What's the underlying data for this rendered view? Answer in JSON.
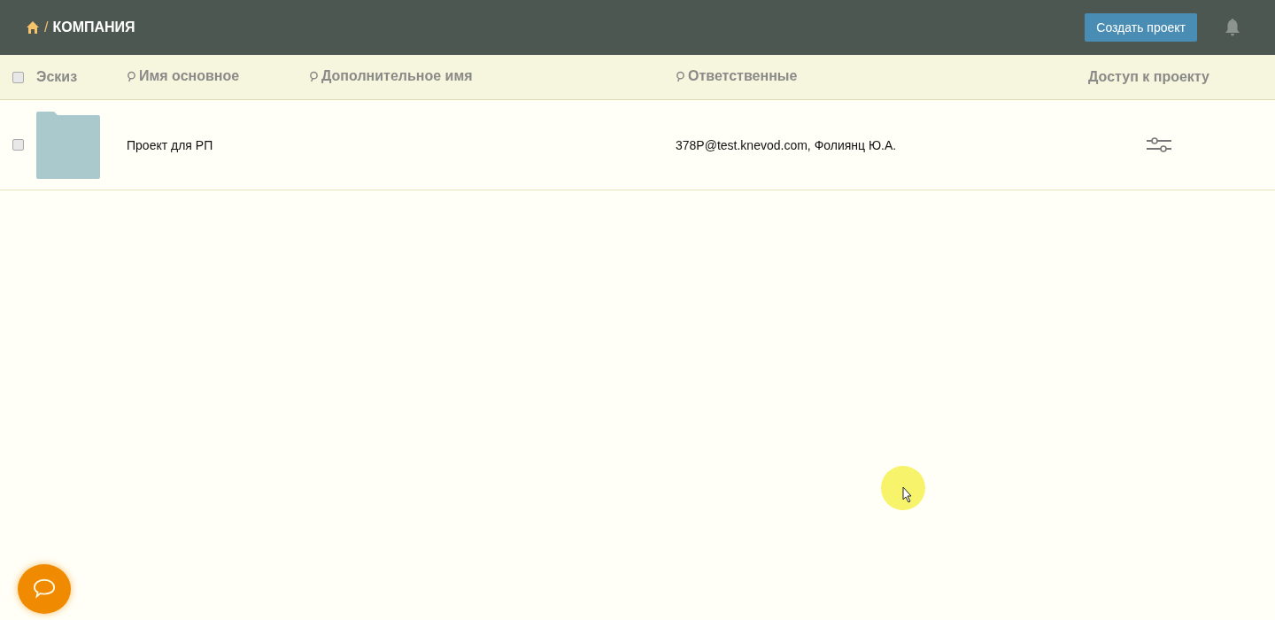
{
  "header": {
    "breadcrumb": "КОМПАНИЯ",
    "separator": "/",
    "create_button": "Создать проект"
  },
  "table": {
    "select_all_checked": false,
    "columns": [
      {
        "label": "Эскиз",
        "searchable": false
      },
      {
        "label": "Имя основное",
        "searchable": true
      },
      {
        "label": "Дополнительное имя",
        "searchable": true
      },
      {
        "label": "Ответственные",
        "searchable": true
      },
      {
        "label": "Доступ к проекту",
        "searchable": false
      }
    ],
    "rows": [
      {
        "checked": false,
        "name": "Проект для РП",
        "column_3": "",
        "responsible": "378P@test.knevod.com, Фолиянц Ю.А."
      }
    ]
  }
}
